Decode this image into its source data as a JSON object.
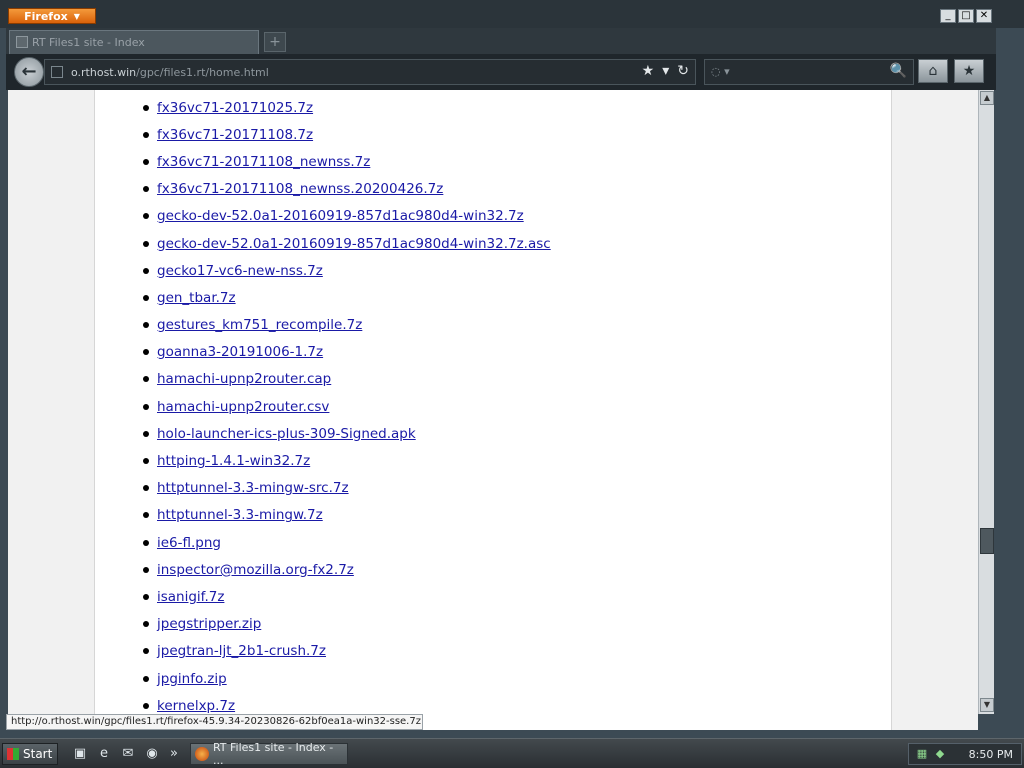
{
  "browser": {
    "menu_button": "Firefox",
    "menu_caret": "▼",
    "window_controls": [
      "_",
      "□",
      "✕"
    ],
    "tab": {
      "title": "RT Files1 site - Index"
    },
    "new_tab": "+",
    "url": {
      "host": "o.rthost.win",
      "path": "/gpc/files1.rt/home.html"
    },
    "url_actions": {
      "bookmark": "★",
      "dropdown": "▾",
      "reload": "↻"
    },
    "search": {
      "engine_icon": "◌ ▾",
      "placeholder": "",
      "go_icon": "🔍"
    },
    "home_icon": "⌂",
    "bookmarks_icon": "★"
  },
  "files": [
    "fx36vc71-20171025.7z",
    "fx36vc71-20171108.7z",
    "fx36vc71-20171108_newnss.7z",
    "fx36vc71-20171108_newnss.20200426.7z",
    "gecko-dev-52.0a1-20160919-857d1ac980d4-win32.7z",
    "gecko-dev-52.0a1-20160919-857d1ac980d4-win32.7z.asc",
    "gecko17-vc6-new-nss.7z",
    "gen_tbar.7z",
    "gestures_km751_recompile.7z",
    "goanna3-20191006-1.7z",
    "hamachi-upnp2router.cap",
    "hamachi-upnp2router.csv",
    "holo-launcher-ics-plus-309-Signed.apk",
    "httping-1.4.1-win32.7z",
    "httptunnel-3.3-mingw-src.7z",
    "httptunnel-3.3-mingw.7z",
    "ie6-fl.png",
    "inspector@mozilla.org-fx2.7z",
    "isanigif.7z",
    "jpegstripper.zip",
    "jpegtran-ljt_2b1-crush.7z",
    "jpginfo.zip",
    "kernelxp.7z"
  ],
  "status": {
    "link_url": "http://o.rthost.win/gpc/files1.rt/firefox-45.9.34-20230826-62bf0ea1a-win32-sse.7z"
  },
  "taskbar": {
    "start_label": "Start",
    "task_label": "RT Files1 site - Index - ...",
    "clock": "8:50 PM",
    "more": "»"
  }
}
